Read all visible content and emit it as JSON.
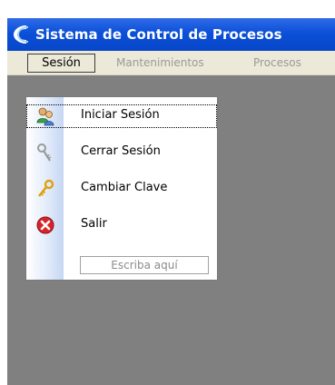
{
  "window": {
    "title": "Sistema de Control de Procesos"
  },
  "menubar": {
    "items": [
      {
        "label": "Sesión"
      },
      {
        "label": "Mantenimientos"
      },
      {
        "label": "Procesos"
      }
    ]
  },
  "session_menu": {
    "items": [
      {
        "label": "Iniciar Sesión",
        "icon": "users-icon"
      },
      {
        "label": "Cerrar Sesión",
        "icon": "keys-icon"
      },
      {
        "label": "Cambiar Clave",
        "icon": "key-icon"
      },
      {
        "label": "Salir",
        "icon": "exit-icon"
      }
    ],
    "new_item_placeholder": "Escriba aquí"
  },
  "colors": {
    "titlebar": "#0b50d8",
    "menubar": "#ece9d8",
    "client_area": "#808080"
  }
}
